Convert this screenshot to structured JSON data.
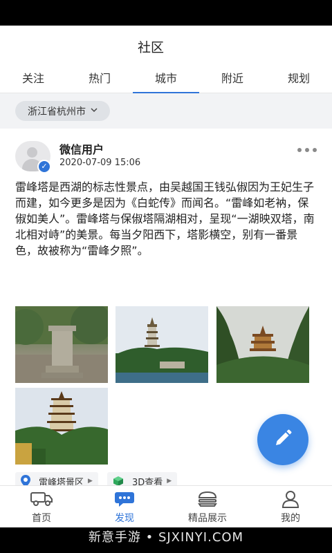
{
  "header": {
    "title": "社区"
  },
  "tabs": [
    {
      "label": "关注"
    },
    {
      "label": "热门"
    },
    {
      "label": "城市",
      "active": true
    },
    {
      "label": "附近"
    },
    {
      "label": "规划"
    }
  ],
  "filter": {
    "city": "浙江省杭州市"
  },
  "post": {
    "username": "微信用户",
    "timestamp": "2020-07-09 15:06",
    "more_glyph": "●●●",
    "text": "雷峰塔是西湖的标志性景点，由吴越国王钱弘俶因为王妃生子而建，如今更多是因为《白蛇传》而闻名。“雷峰如老衲，保俶如美人”。雷峰塔与保俶塔隔湖相对，呈现“一湖映双塔，南北相对峙”的美景。每当夕阳西下，塔影横空，别有一番景色，故被称为“雷峰夕照”。",
    "photos": [
      "photo-stone-stele",
      "photo-pagoda-lake",
      "photo-pagoda-trees",
      "photo-pagoda-hill"
    ],
    "tags": [
      {
        "label": "雷峰塔景区",
        "icon": "location-pin-icon"
      },
      {
        "label": "3D查看",
        "icon": "cube-icon"
      }
    ]
  },
  "bottom_nav": [
    {
      "label": "首页",
      "icon": "truck-icon"
    },
    {
      "label": "发现",
      "icon": "chat-icon",
      "active": true
    },
    {
      "label": "精品展示",
      "icon": "burger-icon"
    },
    {
      "label": "我的",
      "icon": "user-icon"
    }
  ],
  "watermark": "新意手游 • SJXINYI.COM",
  "colors": {
    "accent": "#2f74d8",
    "fab": "#3a85e3"
  }
}
